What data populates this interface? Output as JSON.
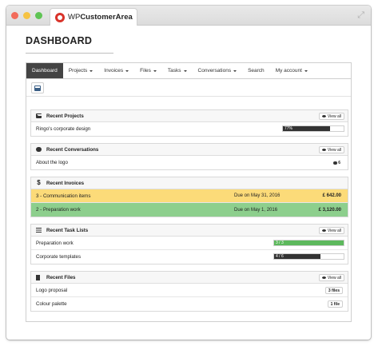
{
  "window": {
    "brand_prefix": "WP",
    "brand_suffix": "CustomerArea"
  },
  "page": {
    "title": "DASHBOARD"
  },
  "nav": {
    "dashboard": "Dashboard",
    "projects": "Projects",
    "invoices": "Invoices",
    "files": "Files",
    "tasks": "Tasks",
    "conversations": "Conversations",
    "search": "Search",
    "account": "My account"
  },
  "view_all_label": "View all",
  "projects": {
    "title": "Recent Projects",
    "items": [
      {
        "name": "Ringo's corporate design",
        "progress": 77,
        "progress_label": "77%"
      }
    ]
  },
  "conversations": {
    "title": "Recent Conversations",
    "items": [
      {
        "name": "About the logo",
        "replies": "6"
      }
    ]
  },
  "invoices": {
    "title": "Recent Invoices",
    "items": [
      {
        "name": "3 - Communication items",
        "due": "Due on May 31, 2016",
        "amount": "£ 642.00",
        "status_color": "#fcdb79"
      },
      {
        "name": "2 - Preparation work",
        "due": "Due on May 1, 2016",
        "amount": "£ 3,120.00",
        "status_color": "#8dcf8d"
      }
    ]
  },
  "tasks": {
    "title": "Recent Task Lists",
    "items": [
      {
        "name": "Preparation work",
        "done": 3,
        "total": 3,
        "label": "3 / 3",
        "bar_color": "#5cb85c"
      },
      {
        "name": "Corporate templates",
        "done": 4,
        "total": 6,
        "label": "4 / 6",
        "bar_color": "#333333"
      }
    ]
  },
  "files": {
    "title": "Recent Files",
    "items": [
      {
        "name": "Logo proposal",
        "count": "3 files"
      },
      {
        "name": "Colour palette",
        "count": "1 file"
      }
    ]
  }
}
